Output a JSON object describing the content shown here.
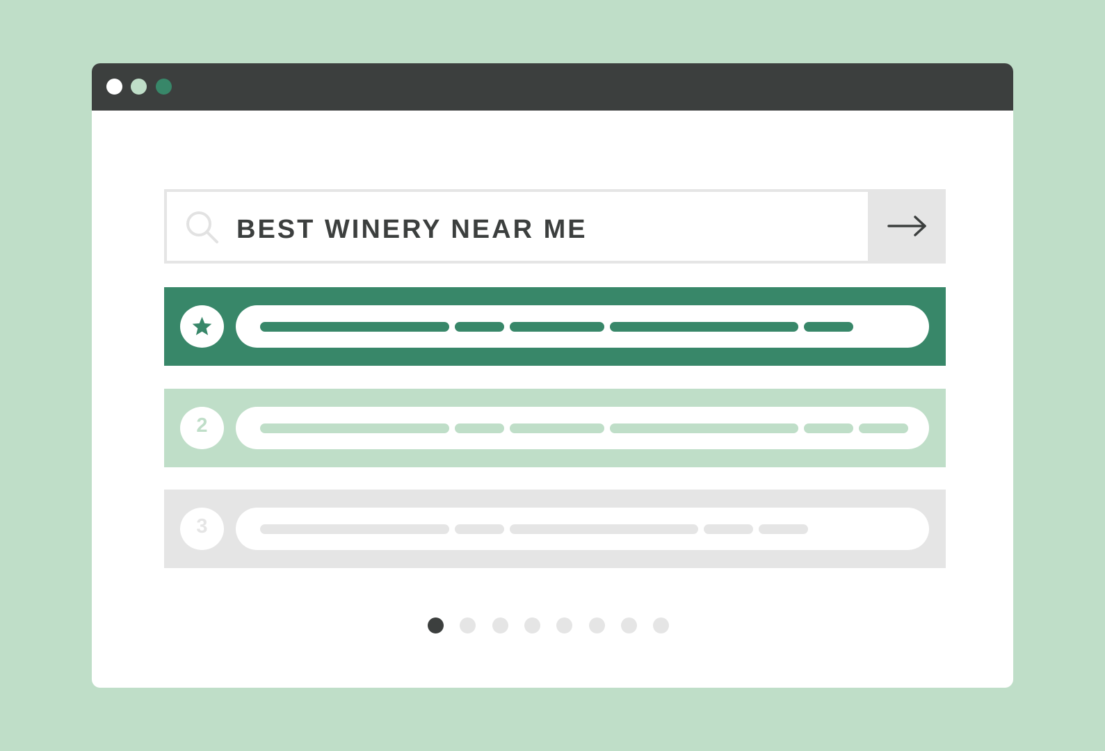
{
  "window": {
    "controls": [
      {
        "name": "close",
        "color": "#ffffff"
      },
      {
        "name": "minimize",
        "color": "#bfdec8"
      },
      {
        "name": "maximize",
        "color": "#388769"
      }
    ]
  },
  "search": {
    "query": "BEST WINERY NEAR ME",
    "icon": "search-icon",
    "submit_icon": "arrow-right-icon"
  },
  "results": [
    {
      "rank": "",
      "icon": "star-icon",
      "highlighted": true
    },
    {
      "rank": "2",
      "icon": "",
      "highlighted": false
    },
    {
      "rank": "3",
      "icon": "",
      "highlighted": false
    }
  ],
  "pagination": {
    "total_pages": 8,
    "current_page": 1
  },
  "colors": {
    "background": "#bfdec8",
    "titlebar": "#3c3f3e",
    "accent": "#388769",
    "accent_light": "#bfdec8",
    "neutral": "#e5e5e5",
    "text": "#3c3f3e"
  }
}
